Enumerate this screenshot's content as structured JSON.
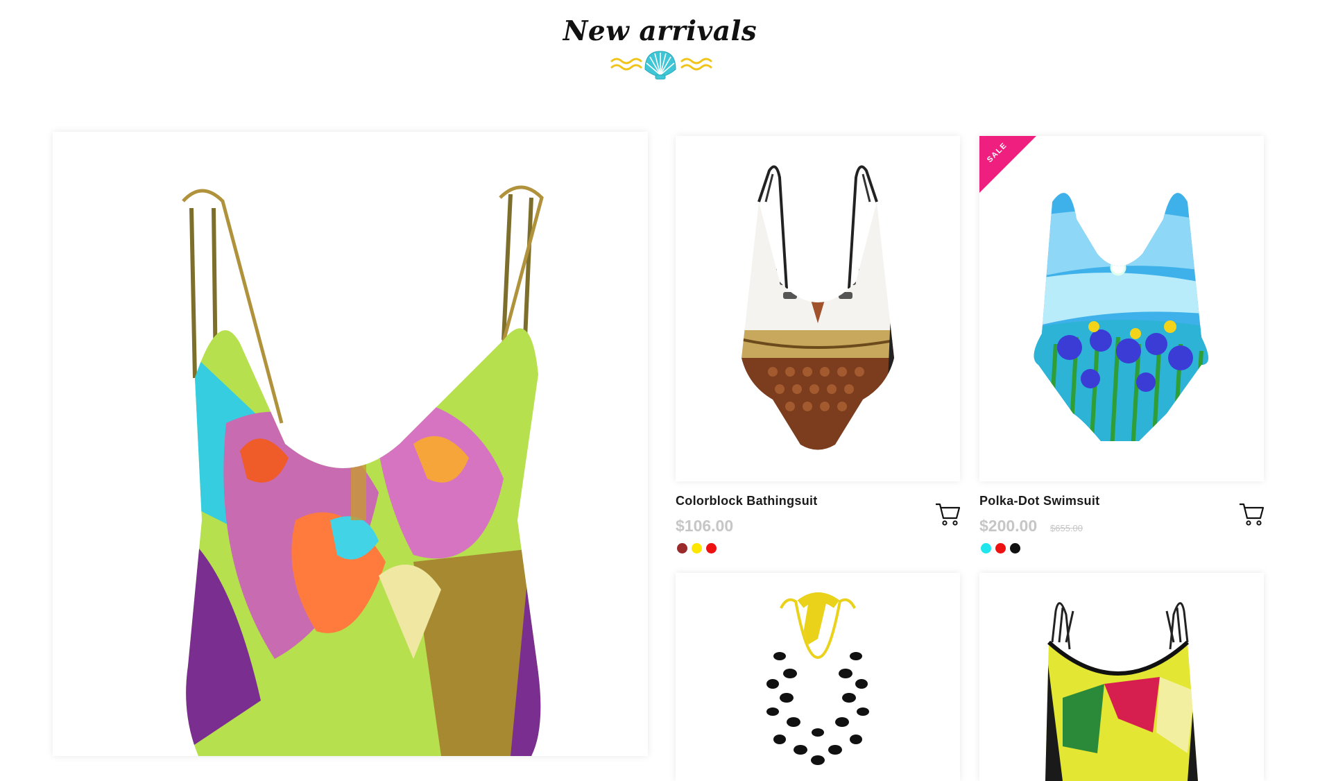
{
  "section": {
    "title": "New arrivals",
    "ornament_icon": "shell-icon",
    "accent": "#f0c419",
    "shell_color": "#3fc6d6"
  },
  "products": [
    {
      "name": "Colorblock Bathingsuit",
      "price": "$106.00",
      "old_price": "",
      "sale": false,
      "swatches": [
        "#9b2b2b",
        "#ffe600",
        "#ee1111"
      ]
    },
    {
      "name": "Polka-Dot Swimsuit",
      "price": "$200.00",
      "old_price": "$655.00",
      "sale": true,
      "sale_label": "SALE",
      "swatches": [
        "#1ee6ec",
        "#ee1111",
        "#111111"
      ]
    }
  ],
  "sale_color": "#ef1f7f"
}
